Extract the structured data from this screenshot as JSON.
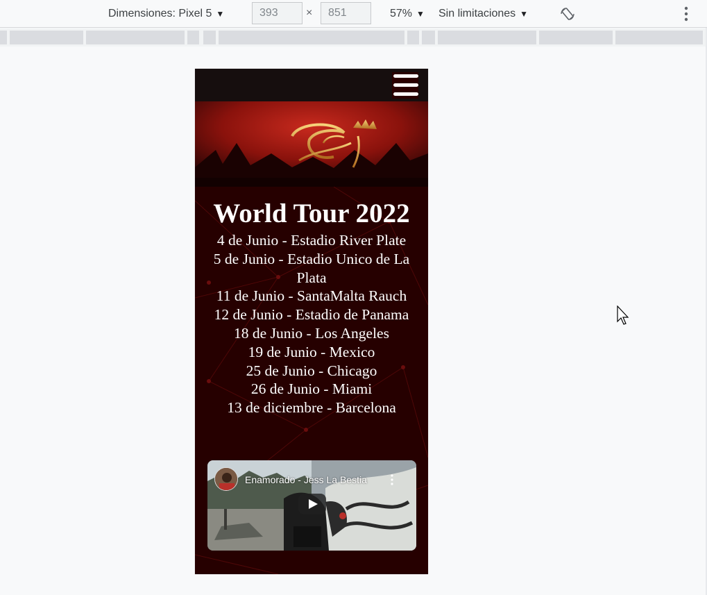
{
  "devtools": {
    "device_label": "Dimensiones: Pixel 5",
    "width_value": "393",
    "height_value": "851",
    "times_symbol": "×",
    "zoom": "57%",
    "throttle": "Sin limitaciones",
    "caret": "▼"
  },
  "site": {
    "tour_title": "World Tour 2022",
    "dates": [
      "4 de Junio - Estadio River Plate",
      "5 de Junio - Estadio Unico de La Plata",
      "11 de Junio - SantaMalta Rauch",
      "12 de Junio - Estadio de Panama",
      "18 de Junio - Los Angeles",
      "19 de Junio - Mexico",
      "25 de Junio - Chicago",
      "26 de Junio - Miami",
      "13 de diciembre - Barcelona"
    ],
    "video_title": "Enamorado - Jess La Bestia"
  },
  "icons": {
    "dropdown": "triangle-down-icon",
    "rotate": "rotate-icon",
    "more": "more-vertical-icon",
    "menu": "hamburger-icon",
    "play": "play-icon",
    "cursor": "mouse-pointer-icon"
  },
  "colors": {
    "page_bg": "#260000",
    "navbar": "#160e0e",
    "text": "#ffffff"
  }
}
